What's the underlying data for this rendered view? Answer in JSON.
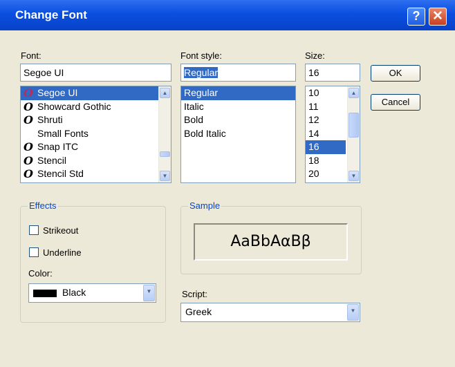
{
  "window": {
    "title": "Change Font"
  },
  "labels": {
    "font": "Font:",
    "font_style": "Font style:",
    "size": "Size:",
    "effects": "Effects",
    "sample": "Sample",
    "color": "Color:",
    "script": "Script:"
  },
  "font": {
    "value": "Segoe UI",
    "items": [
      {
        "name": "Segoe UI",
        "glyph": "O"
      },
      {
        "name": "Showcard Gothic",
        "glyph": "O"
      },
      {
        "name": "Shruti",
        "glyph": "O"
      },
      {
        "name": "Small Fonts",
        "glyph": ""
      },
      {
        "name": "Snap ITC",
        "glyph": "O"
      },
      {
        "name": "Stencil",
        "glyph": "O"
      },
      {
        "name": "Stencil Std",
        "glyph": "O"
      }
    ]
  },
  "style": {
    "value": "Regular",
    "items": [
      "Regular",
      "Italic",
      "Bold",
      "Bold Italic"
    ]
  },
  "size": {
    "value": "16",
    "items": [
      "10",
      "11",
      "12",
      "14",
      "16",
      "18",
      "20"
    ]
  },
  "buttons": {
    "ok": "OK",
    "cancel": "Cancel"
  },
  "effects": {
    "strikeout": "Strikeout",
    "underline": "Underline",
    "color_value": "Black",
    "color_swatch": "#000000"
  },
  "sample_text": "AaBbAαBβ",
  "script": {
    "value": "Greek"
  },
  "icons": {
    "help": "?",
    "close": "✕",
    "scroll_up": "▲",
    "scroll_down": "▼",
    "dropdown": "▼"
  },
  "colors": {
    "titlebar": "#0a4fe0",
    "selection": "#316ac5",
    "group_title": "#0046d5"
  }
}
